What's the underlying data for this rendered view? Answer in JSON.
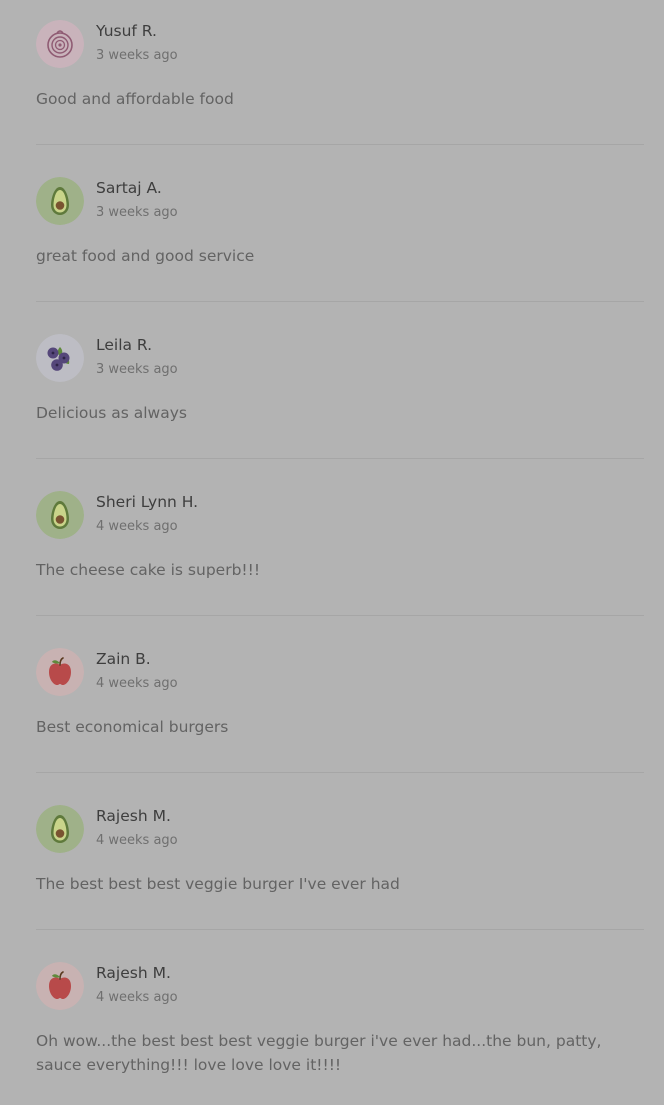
{
  "reviews": [
    {
      "name": "Yusuf R.",
      "time": "3 weeks ago",
      "text": "Good and affordable food",
      "avatar": "onion-icon"
    },
    {
      "name": "Sartaj A.",
      "time": "3 weeks ago",
      "text": "great food and good service",
      "avatar": "avocado-icon"
    },
    {
      "name": "Leila R.",
      "time": "3 weeks ago",
      "text": "Delicious as always",
      "avatar": "blueberries-icon"
    },
    {
      "name": "Sheri Lynn H.",
      "time": "4 weeks ago",
      "text": "The cheese cake is superb!!!",
      "avatar": "avocado-icon"
    },
    {
      "name": "Zain B.",
      "time": "4 weeks ago",
      "text": "Best economical burgers",
      "avatar": "apple-icon"
    },
    {
      "name": "Rajesh M.",
      "time": "4 weeks ago",
      "text": "The best best best veggie burger I've ever had",
      "avatar": "avocado-icon"
    },
    {
      "name": "Rajesh M.",
      "time": "4 weeks ago",
      "text": "Oh wow...the best best best veggie burger i've ever had...the bun, patty, sauce everything!!! love love love it!!!!",
      "avatar": "apple-icon"
    }
  ],
  "colors": {
    "overlay_background": "#b3b3b3",
    "onion_avatar_bg": "#c9b3bb",
    "avocado_avatar_bg": "#9fb189",
    "blueberries_avatar_bg": "#bdbdc4",
    "apple_avatar_bg": "#c8b2b2"
  }
}
